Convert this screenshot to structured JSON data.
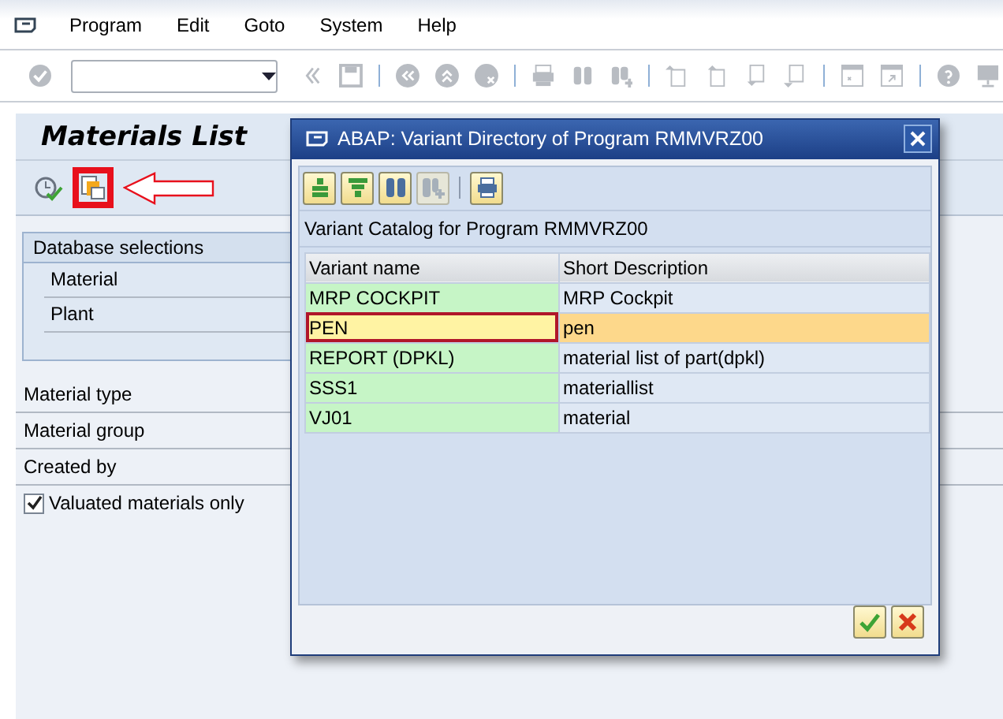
{
  "menu": [
    {
      "label": "Program"
    },
    {
      "label": "Edit"
    },
    {
      "label": "Goto"
    },
    {
      "label": "System"
    },
    {
      "label": "Help"
    }
  ],
  "screen": {
    "title": "Materials List",
    "group": {
      "title": "Database selections",
      "fields": [
        "Material",
        "Plant"
      ]
    },
    "fields": [
      "Material type",
      "Material group",
      "Created by"
    ],
    "checkbox": {
      "label": "Valuated materials only",
      "checked": true
    }
  },
  "dialog": {
    "title": "ABAP: Variant Directory of Program RMMVRZ00",
    "caption": "Variant Catalog for Program RMMVRZ00",
    "columns": [
      "Variant name",
      "Short Description"
    ],
    "rows": [
      {
        "name": "MRP COCKPIT",
        "description": "MRP Cockpit",
        "selected": false
      },
      {
        "name": "PEN",
        "description": "pen",
        "selected": true
      },
      {
        "name": "REPORT (DPKL)",
        "description": "material list of part(dpkl)",
        "selected": false
      },
      {
        "name": "SSS1",
        "description": "materiallist",
        "selected": false
      },
      {
        "name": "VJ01",
        "description": "material",
        "selected": false
      }
    ]
  }
}
